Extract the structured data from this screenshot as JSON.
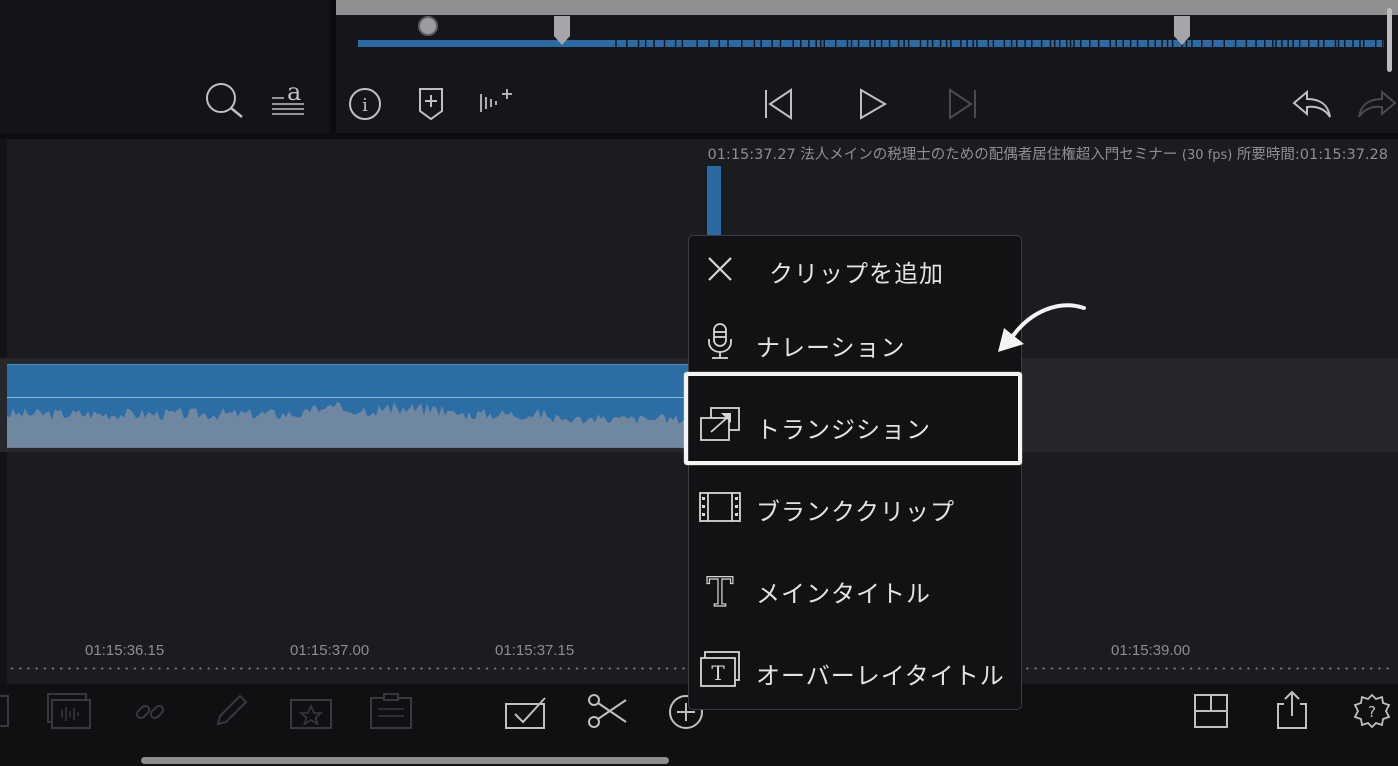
{
  "viewer": {
    "playback_marker_positions": [
      "in",
      "out"
    ]
  },
  "timeline": {
    "info": {
      "timecode": "01:15:37.27",
      "project_name": "法人メインの税理士のための配偶者居住権超入門セミナー",
      "fps": "(30 fps)",
      "duration": "所要時間:01:15:37.28"
    },
    "ruler_labels": [
      "01:15:36.15",
      "01:15:37.00",
      "01:15:37.15",
      "01:15:39.00"
    ]
  },
  "add_clip_menu": {
    "title": "クリップを追加",
    "items": [
      {
        "label": "ナレーション",
        "icon": "microphone-icon"
      },
      {
        "label": "トランジション",
        "icon": "transition-icon"
      },
      {
        "label": "ブランククリップ",
        "icon": "film-strip-icon"
      },
      {
        "label": "メインタイトル",
        "icon": "title-t-icon"
      },
      {
        "label": "オーバーレイタイトル",
        "icon": "overlay-title-icon"
      }
    ],
    "highlighted_item": "トランジション"
  },
  "colors": {
    "accent_blue": "#2b6ea6",
    "background": "#1b1c20",
    "menu_background": "#111214"
  }
}
